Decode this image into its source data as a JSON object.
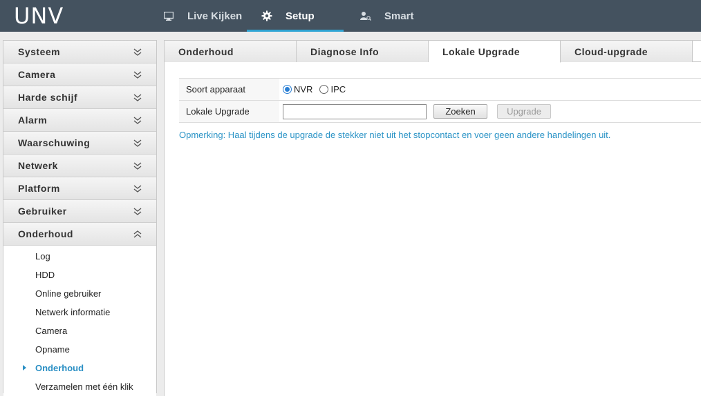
{
  "brand": {
    "logo_text": "UNV"
  },
  "topnav": {
    "items": [
      {
        "label": "Live Kijken",
        "icon": "monitor-icon"
      },
      {
        "label": "Setup",
        "icon": "gear-icon",
        "active": true
      },
      {
        "label": "Smart",
        "icon": "person-search-icon"
      }
    ]
  },
  "sidebar": {
    "groups": [
      {
        "label": "Systeem"
      },
      {
        "label": "Camera"
      },
      {
        "label": "Harde schijf"
      },
      {
        "label": "Alarm"
      },
      {
        "label": "Waarschuwing"
      },
      {
        "label": "Netwerk"
      },
      {
        "label": "Platform"
      },
      {
        "label": "Gebruiker"
      },
      {
        "label": "Onderhoud",
        "expanded": true
      }
    ],
    "subitems": [
      {
        "label": "Log"
      },
      {
        "label": "HDD"
      },
      {
        "label": "Online gebruiker"
      },
      {
        "label": "Netwerk informatie"
      },
      {
        "label": "Camera"
      },
      {
        "label": "Opname"
      },
      {
        "label": "Onderhoud",
        "active": true
      },
      {
        "label": "Verzamelen met één klik"
      }
    ]
  },
  "tabs": [
    {
      "label": "Onderhoud"
    },
    {
      "label": "Diagnose Info"
    },
    {
      "label": "Lokale Upgrade",
      "active": true
    },
    {
      "label": "Cloud-upgrade"
    }
  ],
  "form": {
    "device_type_label": "Soort apparaat",
    "radio_nvr": "NVR",
    "radio_ipc": "IPC",
    "selected": "NVR",
    "local_upgrade_label": "Lokale Upgrade",
    "file_value": "",
    "browse_button": "Zoeken",
    "upgrade_button": "Upgrade"
  },
  "note": "Opmerking: Haal tijdens de upgrade de stekker niet uit het stopcontact en voer geen andere handelingen uit.",
  "colors": {
    "topbar": "#44525f",
    "accent": "#2fa4d3",
    "note": "#2a93c6"
  }
}
